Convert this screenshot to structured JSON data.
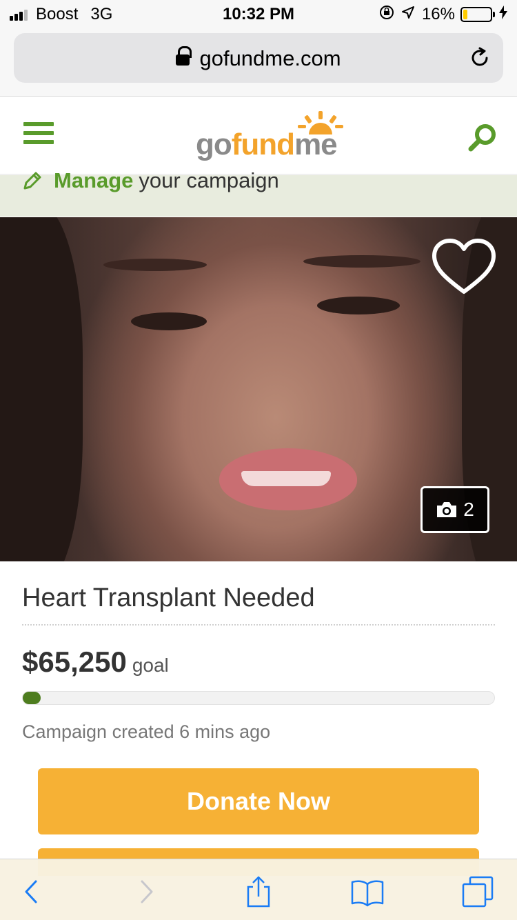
{
  "status_bar": {
    "carrier": "Boost",
    "network": "3G",
    "time": "10:32 PM",
    "battery_percent": "16%",
    "battery_level": 0.16,
    "battery_color": "#ffcc00"
  },
  "url_bar": {
    "domain": "gofundme.com"
  },
  "header": {
    "logo": {
      "part1": "go",
      "part2": "fund",
      "part3": "me"
    },
    "brand_green": "#599b2b",
    "brand_orange": "#f3a32b"
  },
  "manage_banner": {
    "strong": "Manage",
    "rest": "your campaign"
  },
  "photo": {
    "count": "2"
  },
  "campaign": {
    "title": "Heart Transplant Needed",
    "goal_amount": "$65,250",
    "goal_label": "goal",
    "progress_fraction": 0.0,
    "created": "Campaign created 6 mins ago"
  },
  "actions": {
    "donate_label": "Donate Now",
    "button_color": "#f6b135"
  },
  "toolbar": {
    "icons": [
      "back-icon",
      "forward-icon",
      "share-icon",
      "bookmarks-icon",
      "tabs-icon"
    ]
  }
}
